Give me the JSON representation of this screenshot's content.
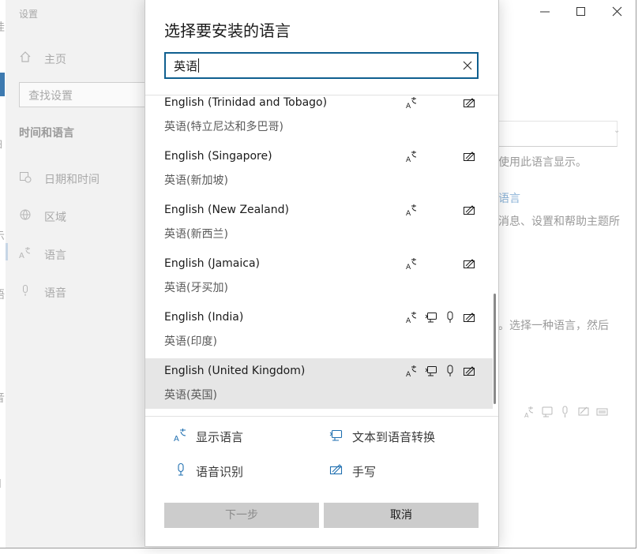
{
  "bg_window": {
    "title": "设置",
    "home_label": "主页",
    "search_placeholder": "查找设置",
    "section_title": "时间和语言",
    "nav": [
      {
        "label": "日期和时间",
        "icon": "calendar-clock-icon"
      },
      {
        "label": "区域",
        "icon": "globe-icon"
      },
      {
        "label": "语言",
        "icon": "language-icon"
      },
      {
        "label": "语音",
        "icon": "microphone-icon"
      }
    ],
    "right_text_1": "使用此语言显示。",
    "right_link": "语言",
    "right_text_2": "消息、设置和帮助主题所",
    "right_text_3": "。选择一种语言，然后",
    "left_edge_fragments": [
      "挂",
      "日",
      "示",
      "语",
      "音",
      "l"
    ]
  },
  "dialog": {
    "title": "选择要安装的语言",
    "search_value": "英语",
    "languages": [
      {
        "name": "English (Trinidad and Tobago)",
        "native": "英语(特立尼达和多巴哥)",
        "features": [
          "display",
          "handwriting"
        ],
        "selected": false
      },
      {
        "name": "English (Singapore)",
        "native": "英语(新加坡)",
        "features": [
          "display",
          "handwriting"
        ],
        "selected": false
      },
      {
        "name": "English (New Zealand)",
        "native": "英语(新西兰)",
        "features": [
          "display",
          "handwriting"
        ],
        "selected": false
      },
      {
        "name": "English (Jamaica)",
        "native": "英语(牙买加)",
        "features": [
          "display",
          "handwriting"
        ],
        "selected": false
      },
      {
        "name": "English (India)",
        "native": "英语(印度)",
        "features": [
          "display",
          "tts",
          "speech",
          "handwriting"
        ],
        "selected": false
      },
      {
        "name": "English (United Kingdom)",
        "native": "英语(英国)",
        "features": [
          "display",
          "tts",
          "speech",
          "handwriting"
        ],
        "selected": true
      }
    ],
    "legend": {
      "display_label": "显示语言",
      "tts_label": "文本到语音转换",
      "speech_label": "语音识别",
      "handwriting_label": "手写"
    },
    "next_label": "下一步",
    "cancel_label": "取消"
  },
  "colors": {
    "accent_border": "#0f5f8f",
    "selected_row": "#e6e6e6",
    "link": "#5b9bd5",
    "button_bg": "#cccccc"
  }
}
